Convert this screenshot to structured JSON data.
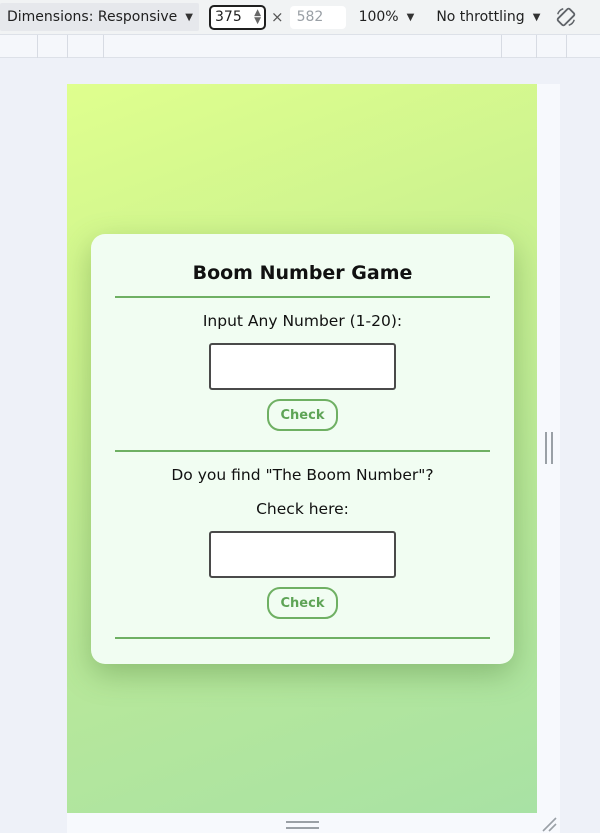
{
  "devtools": {
    "dimensions_label": "Dimensions: Responsive",
    "width_value": "375",
    "times": "×",
    "height_placeholder": "582",
    "zoom": "100%",
    "throttling": "No throttling",
    "rotate_icon": "rotate-icon"
  },
  "game": {
    "title": "Boom Number Game",
    "input_prompt": "Input Any Number (1-20):",
    "input_value": "",
    "check_label": "Check",
    "question": "Do you find \"The Boom Number\"?",
    "check_here": "Check here:",
    "answer_value": "",
    "check2_label": "Check"
  },
  "colors": {
    "gradient_start": "#dfff8e",
    "gradient_end": "#a8e2a4",
    "card_bg": "#f1fdf2",
    "accent_green": "#6fb063"
  }
}
